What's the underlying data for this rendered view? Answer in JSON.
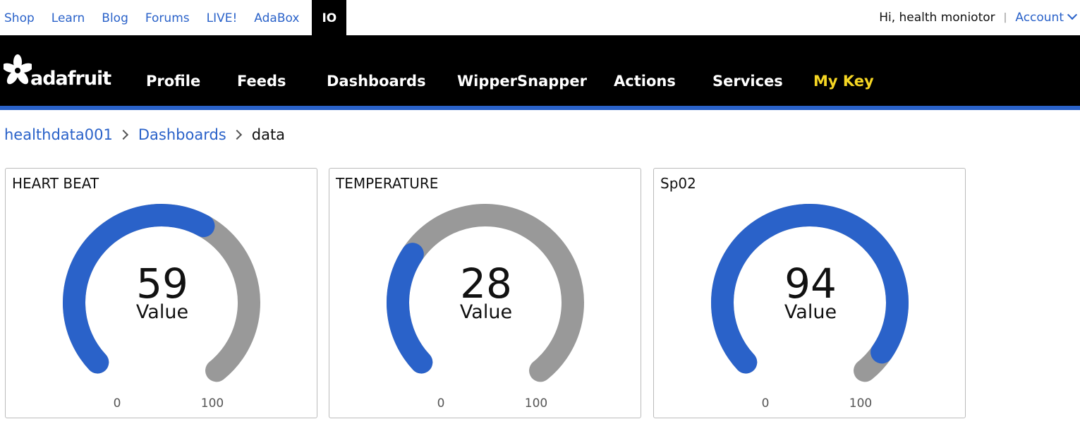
{
  "topbar": {
    "links": [
      "Shop",
      "Learn",
      "Blog",
      "Forums",
      "LIVE!",
      "AdaBox",
      "IO"
    ],
    "active_index": 6,
    "greeting": "Hi, health moniotor",
    "separator": "|",
    "account_label": "Account"
  },
  "brand": {
    "logo_text": "adafruit"
  },
  "nav": {
    "items": [
      "Profile",
      "Feeds",
      "Dashboards",
      "WipperSnapper",
      "Actions",
      "Services"
    ],
    "key_label": "My Key"
  },
  "breadcrumb": {
    "user": "healthdata001",
    "section": "Dashboards",
    "current": "data"
  },
  "colors": {
    "accent": "#2a62c9",
    "gauge_track": "#999999",
    "key_yellow": "#f5d623"
  },
  "gauges": [
    {
      "title": "HEART BEAT",
      "value": "59",
      "value_label": "Value",
      "min_label": "0",
      "max_label": "100",
      "fraction": 0.59
    },
    {
      "title": "TEMPERATURE",
      "value": "28",
      "value_label": "Value",
      "min_label": "0",
      "max_label": "100",
      "fraction": 0.28
    },
    {
      "title": "Sp02",
      "value": "94",
      "value_label": "Value",
      "min_label": "0",
      "max_label": "100",
      "fraction": 0.94
    }
  ]
}
